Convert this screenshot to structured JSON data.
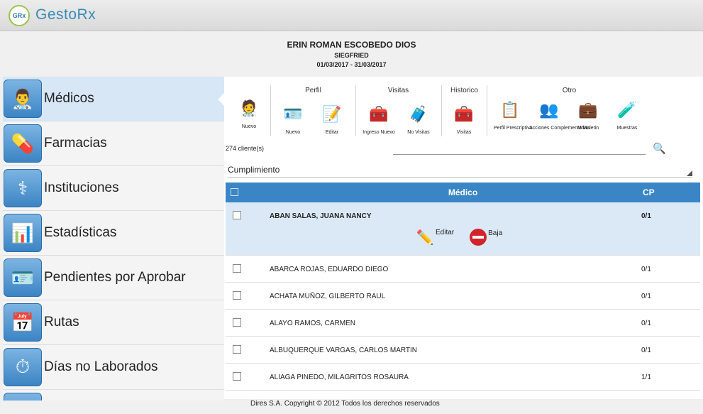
{
  "app": {
    "title": "GestoRx",
    "logo_text": "GRx"
  },
  "header": {
    "name": "ERIN ROMAN ESCOBEDO DIOS",
    "company": "SIEGFRIED",
    "period": "01/03/2017 - 31/03/2017"
  },
  "sidebar": {
    "items": [
      {
        "label": "Médicos",
        "icon": "doctor-icon"
      },
      {
        "label": "Farmacias",
        "icon": "pharmacy-icon"
      },
      {
        "label": "Instituciones",
        "icon": "institution-icon"
      },
      {
        "label": "Estadísticas",
        "icon": "chart-icon"
      },
      {
        "label": "Pendientes por Aprobar",
        "icon": "pending-icon"
      },
      {
        "label": "Rutas",
        "icon": "route-icon"
      },
      {
        "label": "Días no Laborados",
        "icon": "clock-icon"
      }
    ]
  },
  "toolbar": {
    "nuevo": "Nuevo",
    "perfil": {
      "title": "Perfil",
      "nuevo": "Nuevo",
      "editar": "Editar"
    },
    "visitas": {
      "title": "Visitas",
      "ingreso": "Ingreso Nuevo",
      "no_visitas": "No Visitas"
    },
    "historico": {
      "title": "Historico",
      "visitas": "Visitas"
    },
    "otro": {
      "title": "Otro",
      "perfil_prescriptivo": "Perfil Prescriptivo",
      "acciones": "Acciones Complementarias",
      "maletin": "MiMaletin",
      "muestras": "Muestras"
    }
  },
  "list": {
    "count": "274 cliente(s)",
    "search_placeholder": "",
    "filter": "Cumplimiento",
    "headers": {
      "medico": "Médico",
      "cp": "CP"
    },
    "actions": {
      "editar": "Editar",
      "baja": "Baja"
    },
    "rows": [
      {
        "name": "ABAN SALAS, JUANA NANCY",
        "cp": "0/1"
      },
      {
        "name": "ABARCA ROJAS, EDUARDO DIEGO",
        "cp": "0/1"
      },
      {
        "name": "ACHATA MUÑOZ, GILBERTO RAUL",
        "cp": "0/1"
      },
      {
        "name": "ALAYO RAMOS, CARMEN",
        "cp": "0/1"
      },
      {
        "name": "ALBUQUERQUE VARGAS, CARLOS MARTIN",
        "cp": "0/1"
      },
      {
        "name": "ALIAGA PINEDO, MILAGRITOS ROSAURA",
        "cp": "1/1"
      }
    ]
  },
  "footer": {
    "text": "Dires S.A. Copyright © 2012 Todos los derechos reservados"
  }
}
